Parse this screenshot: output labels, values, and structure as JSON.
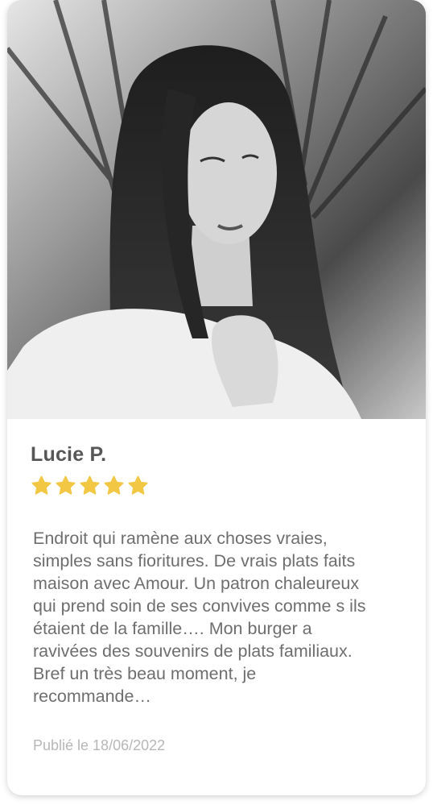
{
  "review_card": {
    "reviewer_name": "Lucie P.",
    "rating": 5,
    "rating_max": 5,
    "star_color": "#f2c744",
    "review_text": "Endroit qui ramène aux choses vraies, simples sans fioritures. De vrais plats faits maison avec Amour. Un patron chaleureux qui prend soin de ses convives comme s ils étaient de la famille…. Mon burger a ravivées des souvenirs de plats familiaux. Bref un très beau moment, je recommande…",
    "published_date": "Publié le 18/06/2022"
  }
}
